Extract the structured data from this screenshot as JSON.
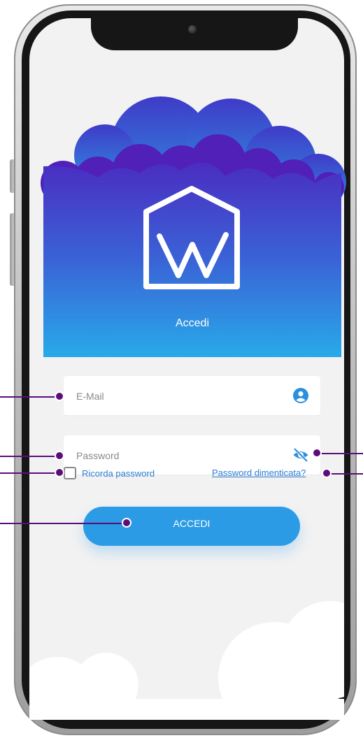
{
  "header": {
    "title": "Accedi"
  },
  "form": {
    "email_placeholder": "E-Mail",
    "password_placeholder": "Password",
    "email_icon": "user-circle-icon",
    "password_icon": "eye-off-icon",
    "remember_label": "Ricorda password",
    "remember_checked": false,
    "forgot_label": "Password dimenticata?",
    "submit_label": "ACCEDI"
  },
  "colors": {
    "accent": "#2b9be6",
    "header_top": "#4b2fc4",
    "header_bottom": "#29a7e8",
    "annotation": "#5b0e7a",
    "link": "#2a7fd4"
  },
  "logo": {
    "icon": "house-w-logo-icon"
  }
}
